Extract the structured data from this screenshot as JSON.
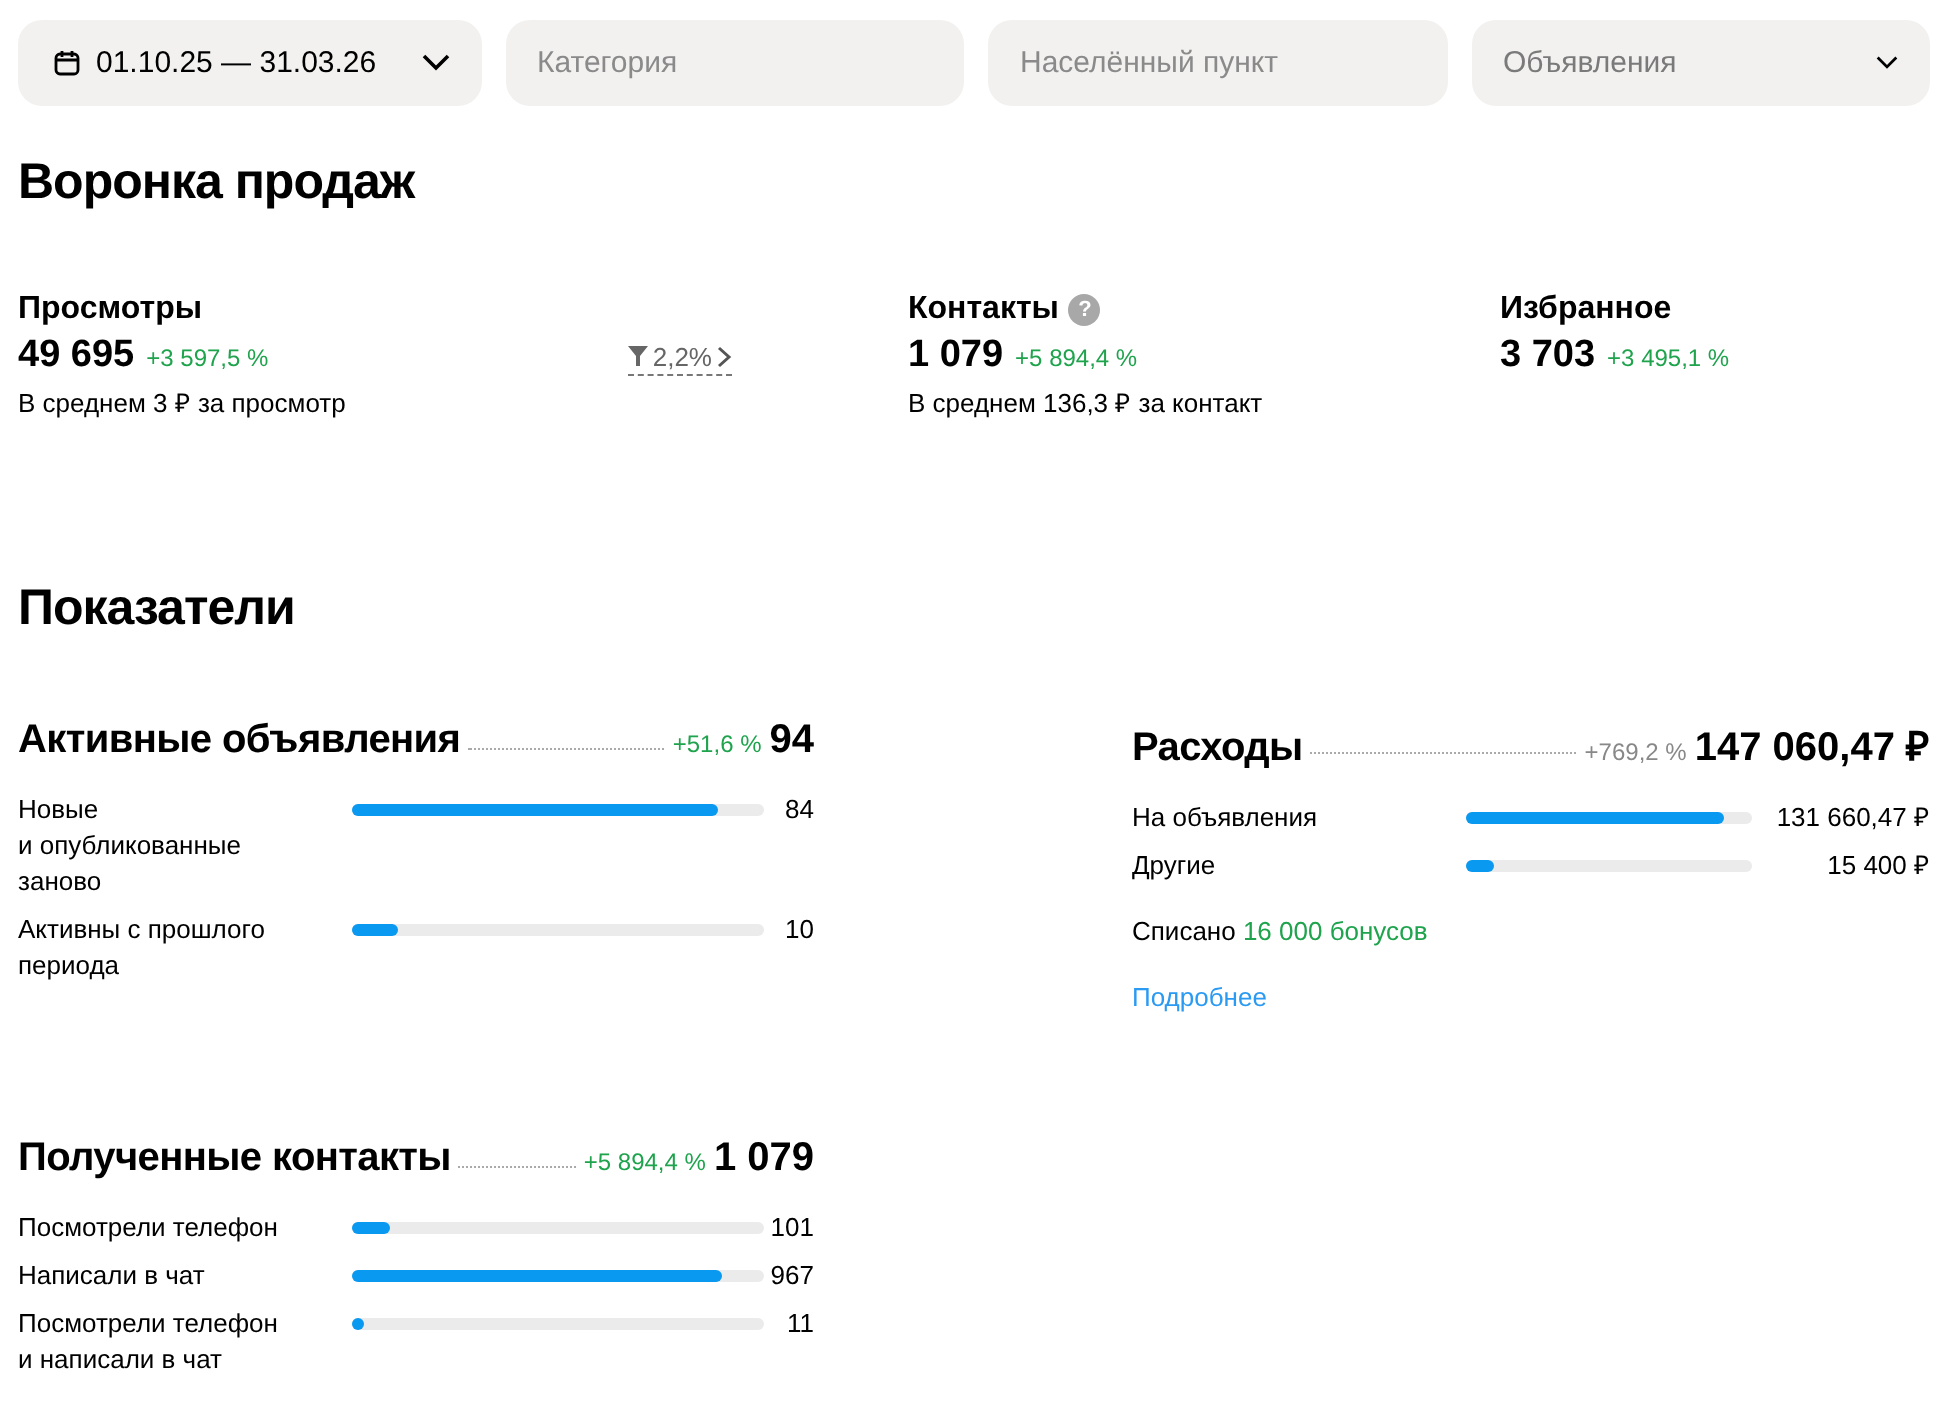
{
  "filters": [
    {
      "kind": "date",
      "value": "01.10.25 — 31.03.26"
    },
    {
      "kind": "input",
      "placeholder": "Категория"
    },
    {
      "kind": "input",
      "placeholder": "Населённый пункт"
    },
    {
      "kind": "select",
      "value": "Объявления"
    }
  ],
  "funnel": {
    "title": "Воронка продаж",
    "metrics": [
      {
        "label": "Просмотры",
        "value": "49 695",
        "delta": "+3 597,5 %",
        "note": "В среднем 3 ₽ за просмотр",
        "conversion": "2,2%"
      },
      {
        "label": "Контакты",
        "help": "?",
        "value": "1 079",
        "delta": "+5 894,4 %",
        "note": "В среднем 136,3 ₽ за контакт"
      },
      {
        "label": "Избранное",
        "value": "3 703",
        "delta": "+3 495,1 %"
      }
    ]
  },
  "indicators": {
    "title": "Показатели",
    "cards": [
      {
        "title": "Активные объявления",
        "delta": "+51,6 %",
        "positive": true,
        "total": "94",
        "rows": [
          {
            "label": "Новые\nи опубликованные\nзаново",
            "level": 0.89,
            "value": "84"
          },
          {
            "label": "Активны с прошлого\nпериода",
            "level": 0.11,
            "value": "10"
          }
        ]
      },
      {
        "title": "Расходы",
        "delta": "+769,2 %",
        "positive": false,
        "total": "147 060,47 ₽",
        "rows": [
          {
            "label": "На объявления",
            "level": 0.9,
            "value": "131 660,47 ₽"
          },
          {
            "label": "Другие",
            "level": 0.1,
            "value": "15 400 ₽"
          }
        ],
        "written_off": {
          "label": "Списано",
          "amount": "16 000 бонусов"
        },
        "link": "Подробнее"
      },
      {
        "title": "Полученные контакты",
        "delta": "+5 894,4 %",
        "positive": true,
        "total": "1 079",
        "rows": [
          {
            "label": "Посмотрели телефон",
            "level": 0.094,
            "value": "101"
          },
          {
            "label": "Написали в чат",
            "level": 0.896,
            "value": "967"
          },
          {
            "label": "Посмотрели телефон\nи написали в чат",
            "level": 0.01,
            "value": "11"
          }
        ]
      }
    ]
  }
}
